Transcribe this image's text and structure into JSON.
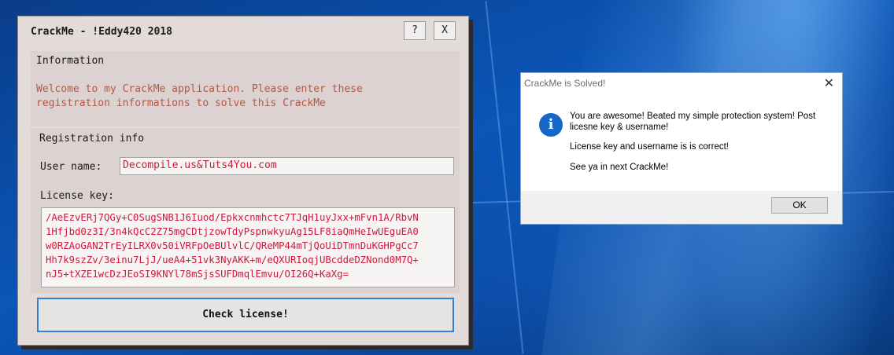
{
  "crackme": {
    "title": "CrackMe - !Eddy420 2018",
    "help_label": "?",
    "close_label": "X",
    "information": {
      "title": "Information",
      "welcome_line1": "Welcome to my CrackMe application. Please enter these",
      "welcome_line2": "registration informations to solve this CrackMe"
    },
    "registration": {
      "title": "Registration info",
      "user_label": "User name:",
      "user_value": "Decompile.us&Tuts4You.com",
      "license_label": "License key:",
      "license_value": "/AeEzvERj7QGy+C0SugSNB1J6Iuod/Epkxcnmhctc7TJqH1uyJxx+mFvn1A/RbvN\n1Hfjbd0z3I/3n4kQcC2Z75mgCDtjzowTdyPspnwkyuAg15LF8iaQmHeIwUEguEA0\nw0RZAoGAN2TrEyILRX0v50iVRFpOeBUlvlC/QReMP44mTjQoUiDTmnDuKGHPgCc7\nHh7k9szZv/3einu7LjJ/ueA4+51vk3NyAKK+m/eQXURIoqjUBcddeDZNond0M7Q+\nnJ5+tXZE1wcDzJEoSI9KNYl78mSjsSUFDmqlEmvu/OI26Q+KaXg="
    },
    "check_button": "Check license!"
  },
  "msgbox": {
    "title": "CrackMe is Solved!",
    "close_label": "✕",
    "icon": "info-icon",
    "line1": "You are awesome! Beated my simple protection system! Post",
    "line2": "licesne key & username!",
    "line3": "License key and username is is correct!",
    "line4": "See ya in next CrackMe!",
    "ok_label": "OK"
  }
}
